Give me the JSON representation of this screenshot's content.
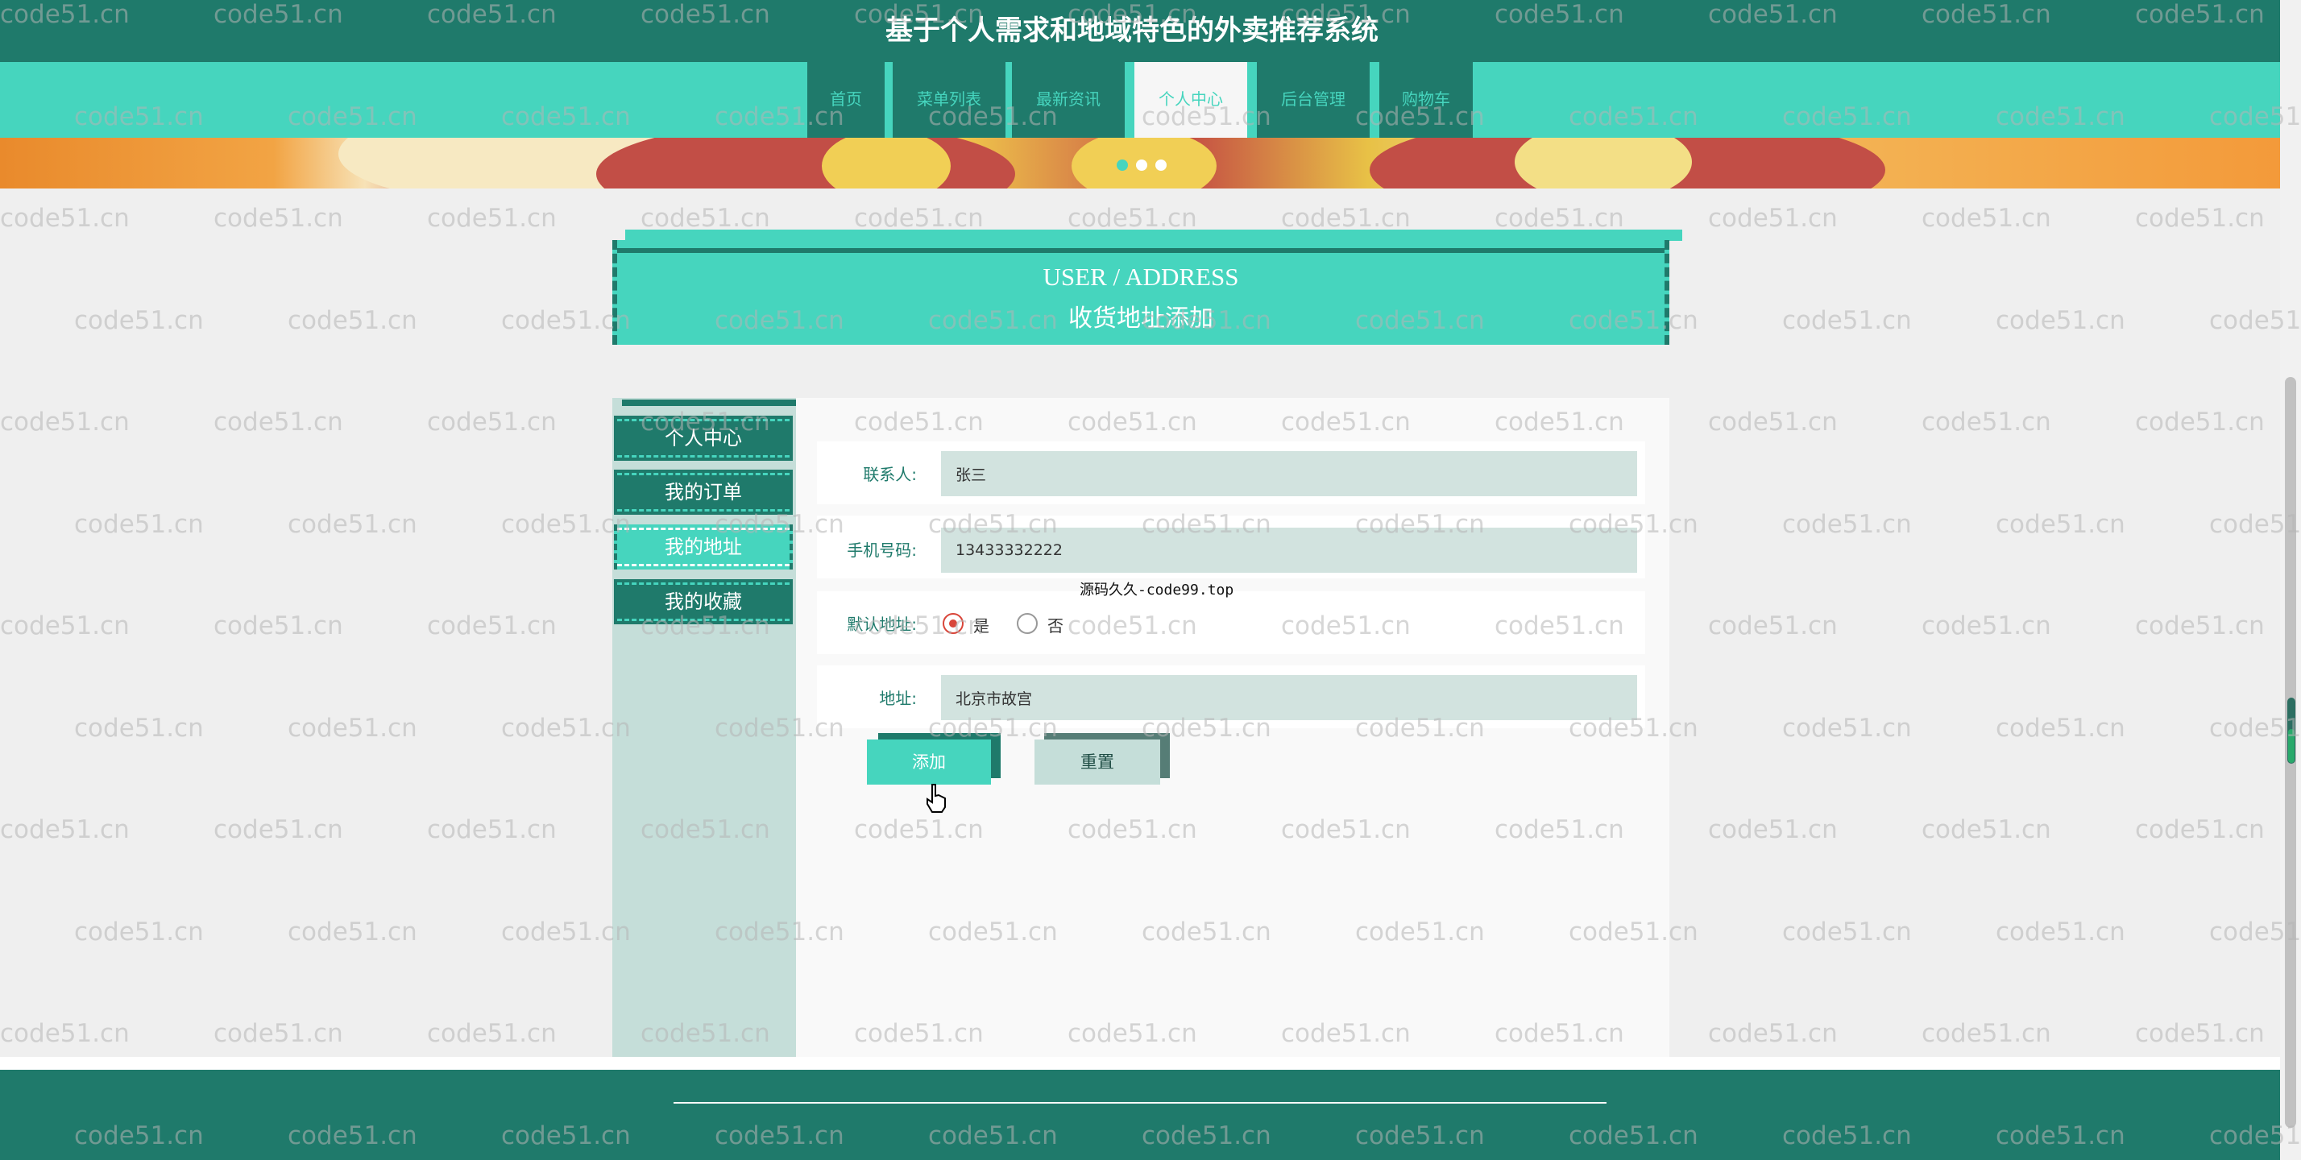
{
  "site": {
    "title": "基于个人需求和地域特色的外卖推荐系统"
  },
  "nav": {
    "items": [
      {
        "label": "首页"
      },
      {
        "label": "菜单列表"
      },
      {
        "label": "最新资讯"
      },
      {
        "label": "个人中心",
        "active": true
      },
      {
        "label": "后台管理"
      },
      {
        "label": "购物车"
      }
    ]
  },
  "banner": {
    "dots": 3,
    "active_dot": 0
  },
  "section": {
    "title_en": "USER / ADDRESS",
    "title_cn": "收货地址添加"
  },
  "sidebar": {
    "items": [
      {
        "label": "个人中心"
      },
      {
        "label": "我的订单"
      },
      {
        "label": "我的地址",
        "active": true
      },
      {
        "label": "我的收藏"
      }
    ]
  },
  "form": {
    "contact": {
      "label": "联系人:",
      "value": "张三"
    },
    "phone": {
      "label": "手机号码:",
      "value": "13433332222"
    },
    "default_address": {
      "label": "默认地址:",
      "options": [
        "是",
        "否"
      ],
      "selected": "是"
    },
    "address": {
      "label": "地址:",
      "value": "北京市故宫"
    },
    "add_button": "添加",
    "reset_button": "重置"
  },
  "notice": "源码久久-code99.top",
  "watermark_text": "code51.cn",
  "colors": {
    "dark_teal": "#1f7a6b",
    "teal": "#46d5be",
    "sidebar_bg": "#c5ded9",
    "input_bg": "#d2e3df",
    "radio_red": "#d9463a"
  }
}
